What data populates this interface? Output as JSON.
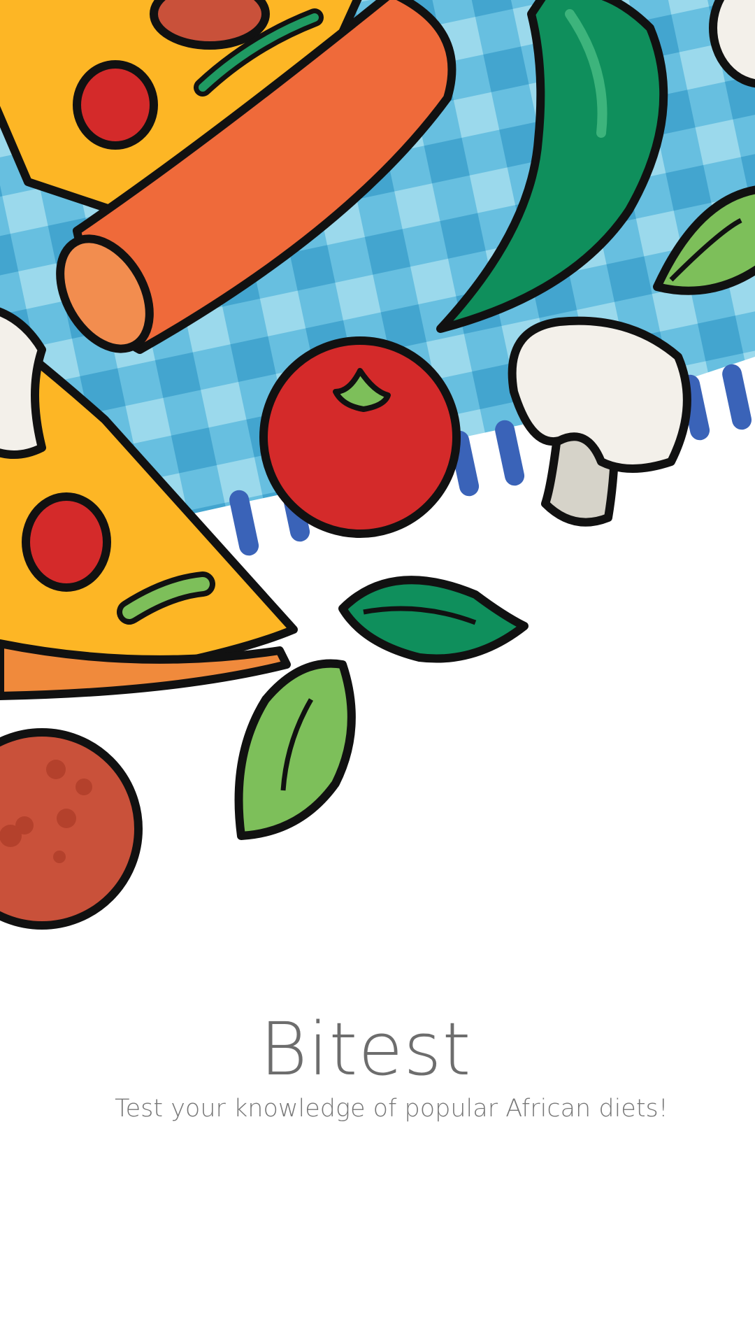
{
  "splash": {
    "app_name": "Bitest",
    "tagline": "Test your knowledge of popular African diets!"
  },
  "illustration": {
    "items": [
      "pizza-slice",
      "sausage",
      "chili-pepper",
      "basil-leaf",
      "tomato",
      "mushroom",
      "pepperoni",
      "checkered-tablecloth"
    ]
  },
  "colors": {
    "title": "#6d6d6d",
    "tagline": "#777777",
    "tablecloth_light": "#86d0e6",
    "tablecloth_dark": "#3aa4cf",
    "tomato": "#d42a2a",
    "pepper": "#0f8f5c",
    "cheese": "#fdb625",
    "sausage": "#ef6a3a"
  }
}
